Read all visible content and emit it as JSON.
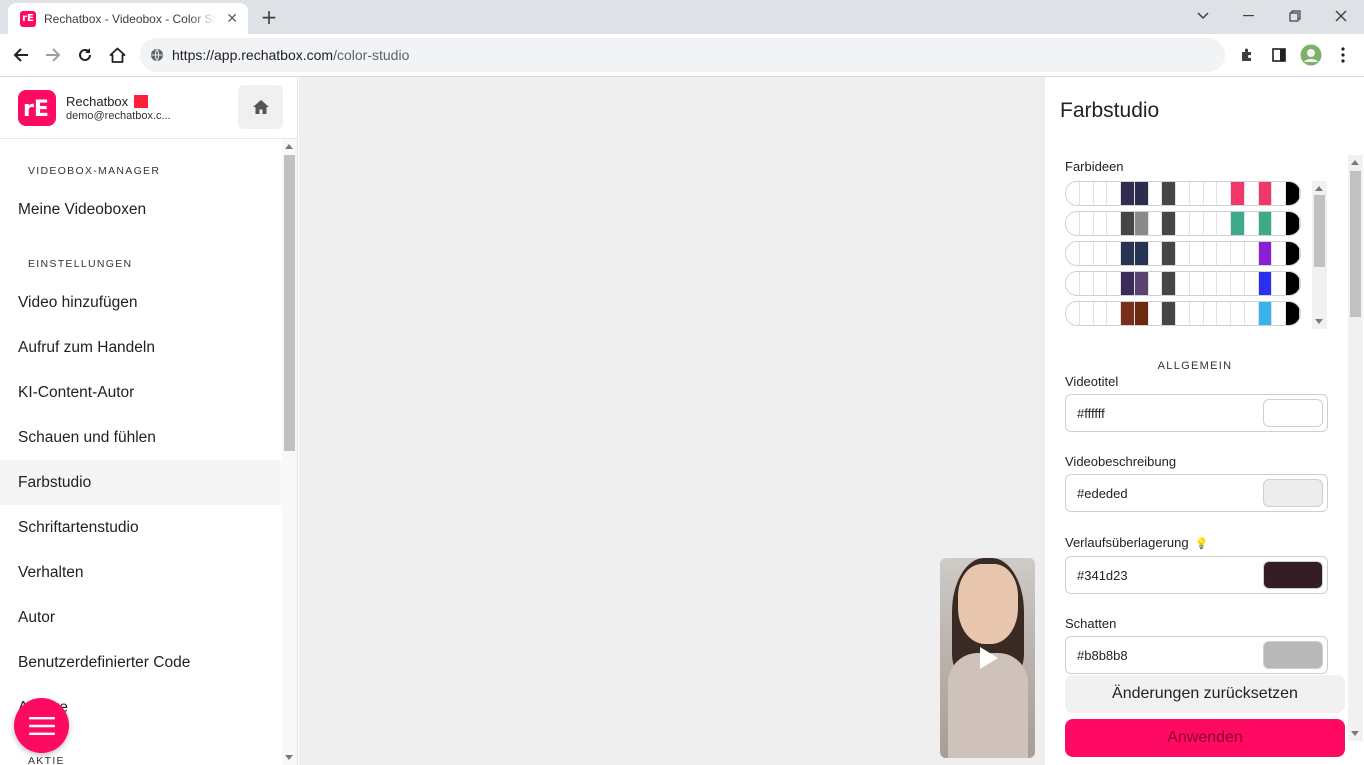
{
  "browser": {
    "tab_title": "Rechatbox - Videobox - Color Studio",
    "favicon_text": "rE",
    "url_host": "https://app.rechatbox.com",
    "url_path": "/color-studio"
  },
  "sidebar": {
    "brand_name": "Rechatbox",
    "brand_email": "demo@rechatbox.c...",
    "sections": [
      {
        "label": "VIDEOBOX-MANAGER"
      },
      {
        "label": "EINSTELLUNGEN"
      },
      {
        "label": "AKTIE"
      }
    ],
    "items": [
      {
        "label": "Meine Videoboxen"
      },
      {
        "label": "Video hinzufügen"
      },
      {
        "label": "Aufruf zum Handeln"
      },
      {
        "label": "KI-Content-Autor"
      },
      {
        "label": "Schauen und fühlen"
      },
      {
        "label": "Farbstudio"
      },
      {
        "label": "Schriftartenstudio"
      },
      {
        "label": "Verhalten"
      },
      {
        "label": "Autor"
      },
      {
        "label": "Benutzerdefinierter Code"
      },
      {
        "label": "Andere"
      }
    ]
  },
  "panel": {
    "title": "Farbstudio",
    "palettes_label": "Farbideen",
    "palettes": [
      [
        "#ffffff",
        "#ffffff",
        "#ffffff",
        "#ffffff",
        "#342c4f",
        "#2c2d4d",
        "#ffffff",
        "#4a4545",
        "#ffffff",
        "#ffffff",
        "#ffffff",
        "#ffffff",
        "#f0386b",
        "#ffffff",
        "#f0386b",
        "#ffffff",
        "#000000"
      ],
      [
        "#ffffff",
        "#ffffff",
        "#ffffff",
        "#ffffff",
        "#454545",
        "#8a8a8a",
        "#ffffff",
        "#4a4545",
        "#ffffff",
        "#ffffff",
        "#ffffff",
        "#ffffff",
        "#3daa8a",
        "#ffffff",
        "#3daa8a",
        "#ffffff",
        "#000000"
      ],
      [
        "#ffffff",
        "#ffffff",
        "#ffffff",
        "#ffffff",
        "#263352",
        "#263352",
        "#ffffff",
        "#4a4545",
        "#ffffff",
        "#ffffff",
        "#ffffff",
        "#ffffff",
        "#ffffff",
        "#ffffff",
        "#8a1fd6",
        "#ffffff",
        "#000000"
      ],
      [
        "#ffffff",
        "#ffffff",
        "#ffffff",
        "#ffffff",
        "#3c2a5a",
        "#5a4470",
        "#ffffff",
        "#4a4545",
        "#ffffff",
        "#ffffff",
        "#ffffff",
        "#ffffff",
        "#ffffff",
        "#ffffff",
        "#2a2ff0",
        "#ffffff",
        "#000000"
      ],
      [
        "#ffffff",
        "#ffffff",
        "#ffffff",
        "#ffffff",
        "#7a2e1c",
        "#6b2a10",
        "#ffffff",
        "#4a4545",
        "#ffffff",
        "#ffffff",
        "#ffffff",
        "#ffffff",
        "#ffffff",
        "#ffffff",
        "#39b3f0",
        "#ffffff",
        "#000000"
      ]
    ],
    "section_general": "ALLGEMEIN",
    "fields": [
      {
        "label": "Videotitel",
        "value": "#ffffff",
        "swatch": "#ffffff"
      },
      {
        "label": "Videobeschreibung",
        "value": "#ededed",
        "swatch": "#ededed"
      },
      {
        "label": "Verlaufsüberlagerung",
        "value": "#341d23",
        "swatch": "#341d23"
      },
      {
        "label": "Schatten",
        "value": "#b8b8b8",
        "swatch": "#b8b8b8"
      }
    ],
    "reset_label": "Änderungen zurücksetzen",
    "apply_label": "Anwenden"
  },
  "colors": {
    "brand": "#ff0a63",
    "brand_square": "#ff1f3a"
  },
  "icons": [
    "back-icon",
    "forward-icon",
    "reload-icon",
    "home-icon",
    "site-info-icon",
    "extensions-icon",
    "side-panel-icon",
    "profile-icon",
    "menu-dots-icon",
    "close-icon",
    "minimize-icon",
    "maximize-icon",
    "hamburger-icon",
    "play-icon",
    "bulb-icon"
  ]
}
